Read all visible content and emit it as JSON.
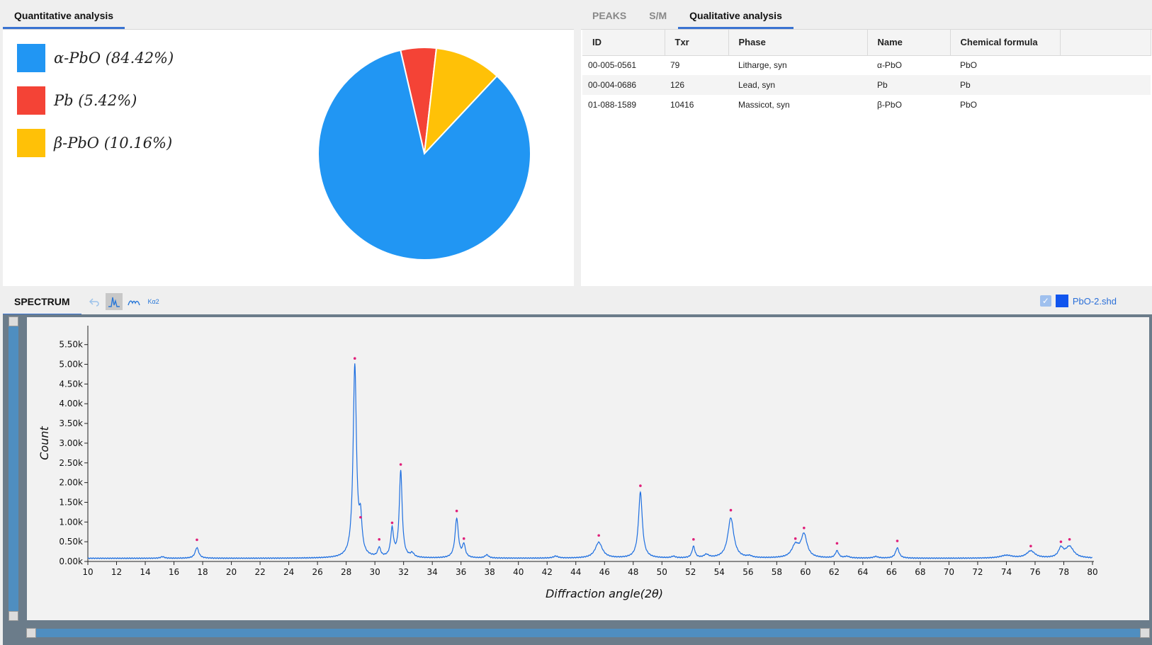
{
  "quant": {
    "tab_label": "Quantitative analysis",
    "legend": [
      {
        "label": "α-PbO (84.42%)",
        "color": "#2196F3"
      },
      {
        "label": "Pb (5.42%)",
        "color": "#F44336"
      },
      {
        "label": "β-PbO (10.16%)",
        "color": "#FFC107"
      }
    ]
  },
  "qual": {
    "tabs": [
      "PEAKS",
      "S/M",
      "Qualitative analysis"
    ],
    "active_tab": 2,
    "columns": [
      "ID",
      "Txr",
      "Phase",
      "Name",
      "Chemical formula"
    ],
    "rows": [
      {
        "id": "00-005-0561",
        "txr": "79",
        "phase": "Litharge, syn",
        "name": "α-PbO",
        "formula": "PbO"
      },
      {
        "id": "00-004-0686",
        "txr": "126",
        "phase": "Lead, syn",
        "name": "Pb",
        "formula": "Pb"
      },
      {
        "id": "01-088-1589",
        "txr": "10416",
        "phase": "Massicot, syn",
        "name": "β-PbO",
        "formula": "PbO"
      }
    ]
  },
  "spectrum": {
    "tab_label": "SPECTRUM",
    "tools": [
      "undo-icon",
      "peak-icon",
      "smooth-icon",
      "ka2-icon"
    ],
    "ka2_label": "Kα2",
    "file_name": "PbO-2.shd",
    "file_checked": true,
    "file_color": "#1155EE"
  },
  "chart_data": [
    {
      "type": "pie",
      "categories": [
        "α-PbO",
        "Pb",
        "β-PbO"
      ],
      "values": [
        84.42,
        5.42,
        10.16
      ],
      "colors": [
        "#2196F3",
        "#F44336",
        "#FFC107"
      ]
    },
    {
      "type": "line",
      "xlabel": "Diffraction angle(2θ)",
      "ylabel": "Count",
      "xlim": [
        10,
        80
      ],
      "ylim": [
        0,
        5800
      ],
      "x_ticks": [
        10,
        12,
        14,
        16,
        18,
        20,
        22,
        24,
        26,
        28,
        30,
        32,
        34,
        36,
        38,
        40,
        42,
        44,
        46,
        48,
        50,
        52,
        54,
        56,
        58,
        60,
        62,
        64,
        66,
        68,
        70,
        72,
        74,
        76,
        78,
        80
      ],
      "y_ticks": [
        "0.00k",
        "0.50k",
        "1.00k",
        "1.50k",
        "2.00k",
        "2.50k",
        "3.00k",
        "3.50k",
        "4.00k",
        "4.50k",
        "5.00k",
        "5.50k"
      ],
      "baseline": 80,
      "series": [
        {
          "color": "#1E6FE0",
          "peaks": [
            [
              15.2,
              40,
              0.15
            ],
            [
              17.6,
              270,
              0.15
            ],
            [
              28.6,
              4870,
              0.14
            ],
            [
              29.0,
              820,
              0.12
            ],
            [
              30.3,
              230,
              0.12
            ],
            [
              31.2,
              700,
              0.12
            ],
            [
              31.8,
              2200,
              0.12
            ],
            [
              32.6,
              100,
              0.15
            ],
            [
              35.7,
              1000,
              0.14
            ],
            [
              36.2,
              320,
              0.12
            ],
            [
              37.8,
              80,
              0.15
            ],
            [
              42.6,
              50,
              0.2
            ],
            [
              45.6,
              400,
              0.3
            ],
            [
              48.5,
              1670,
              0.16
            ],
            [
              50.8,
              40,
              0.15
            ],
            [
              52.2,
              290,
              0.12
            ],
            [
              53.1,
              80,
              0.2
            ],
            [
              54.8,
              1020,
              0.25
            ],
            [
              56.1,
              40,
              0.2
            ],
            [
              59.3,
              310,
              0.3
            ],
            [
              59.9,
              580,
              0.25
            ],
            [
              62.2,
              180,
              0.14
            ],
            [
              62.9,
              40,
              0.2
            ],
            [
              64.9,
              40,
              0.2
            ],
            [
              66.4,
              260,
              0.15
            ],
            [
              74.0,
              70,
              0.5
            ],
            [
              75.7,
              180,
              0.35
            ],
            [
              77.8,
              230,
              0.2
            ],
            [
              78.4,
              290,
              0.35
            ]
          ]
        }
      ],
      "markers": [
        [
          17.6,
          550
        ],
        [
          28.6,
          5150
        ],
        [
          29.0,
          1120
        ],
        [
          30.3,
          560
        ],
        [
          31.2,
          980
        ],
        [
          31.8,
          2460
        ],
        [
          35.7,
          1280
        ],
        [
          36.2,
          580
        ],
        [
          45.6,
          660
        ],
        [
          48.5,
          1920
        ],
        [
          52.2,
          560
        ],
        [
          54.8,
          1300
        ],
        [
          59.3,
          580
        ],
        [
          59.9,
          850
        ],
        [
          62.2,
          460
        ],
        [
          66.4,
          520
        ],
        [
          75.7,
          390
        ],
        [
          77.8,
          500
        ],
        [
          78.4,
          560
        ]
      ],
      "marker_color": "#E0207A"
    }
  ]
}
